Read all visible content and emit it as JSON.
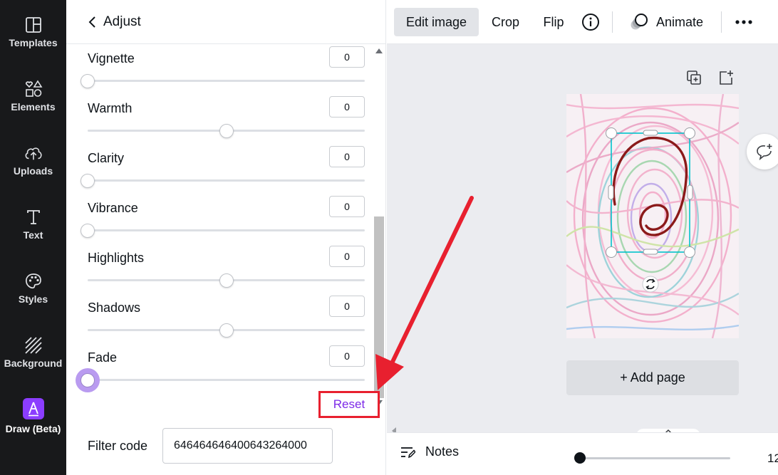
{
  "left_nav": {
    "items": [
      {
        "label": "Templates",
        "icon": "templates-icon"
      },
      {
        "label": "Elements",
        "icon": "elements-icon"
      },
      {
        "label": "Uploads",
        "icon": "uploads-icon"
      },
      {
        "label": "Text",
        "icon": "text-icon"
      },
      {
        "label": "Styles",
        "icon": "styles-icon"
      },
      {
        "label": "Background",
        "icon": "background-icon"
      },
      {
        "label": "Draw (Beta)",
        "icon": "draw-icon"
      }
    ]
  },
  "panel": {
    "back_label": "Adjust",
    "adjustments": [
      {
        "label": "Vignette",
        "value": "0",
        "level": 0.0
      },
      {
        "label": "Warmth",
        "value": "0",
        "level": 0.5
      },
      {
        "label": "Clarity",
        "value": "0",
        "level": 0.0
      },
      {
        "label": "Vibrance",
        "value": "0",
        "level": 0.0
      },
      {
        "label": "Highlights",
        "value": "0",
        "level": 0.5
      },
      {
        "label": "Shadows",
        "value": "0",
        "level": 0.5
      },
      {
        "label": "Fade",
        "value": "0",
        "level": 0.0
      }
    ],
    "reset_label": "Reset",
    "filter_code_label": "Filter code",
    "filter_code_value": "646464646400643264000"
  },
  "toolbar": {
    "edit_image_label": "Edit image",
    "crop_label": "Crop",
    "flip_label": "Flip",
    "animate_label": "Animate"
  },
  "canvas": {
    "add_page_label": "+ Add page"
  },
  "bottombar": {
    "notes_label": "Notes",
    "zoom_text": "12"
  },
  "colors": {
    "accent": "#8b3dff",
    "reset_text": "#7d2ae8",
    "annotation_red": "#e8202f",
    "nav_bg": "#18191b",
    "drawing_stroke": "#8b1a1a",
    "selection": "#00c4cc"
  }
}
